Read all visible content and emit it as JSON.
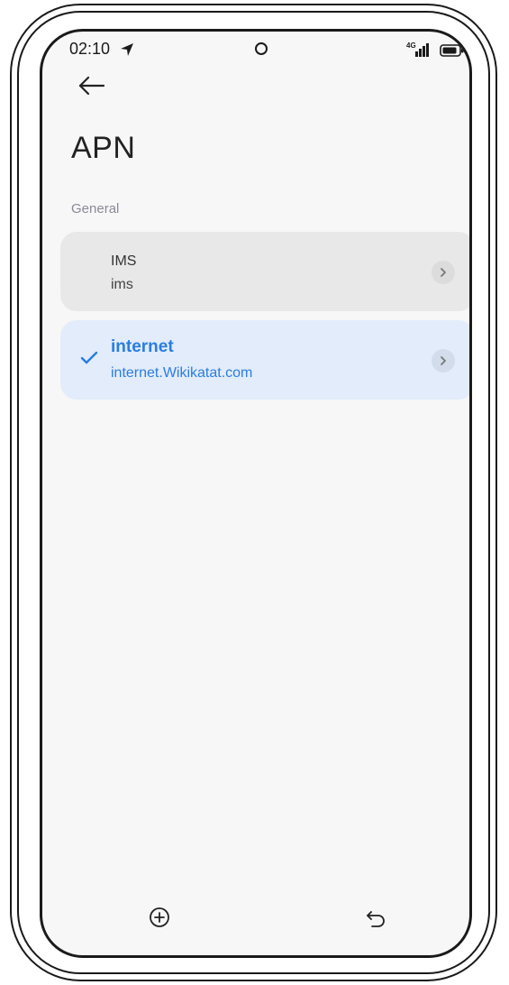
{
  "status_bar": {
    "time": "02:10",
    "network": "4G"
  },
  "page": {
    "title": "APN",
    "section_label": "General"
  },
  "apn_list": [
    {
      "name": "IMS",
      "value": "ims",
      "selected": false
    },
    {
      "name": "internet",
      "value": "internet.Wikikatat.com",
      "selected": true
    }
  ],
  "colors": {
    "accent": "#2a7de1",
    "selected_bg": "#e2ecfa",
    "item_bg": "#e8e8e8",
    "screen_bg": "#f7f7f7"
  },
  "icons": {
    "back": "arrow-left-icon",
    "add": "plus-circle-icon",
    "reset": "undo-icon",
    "check": "check-icon",
    "chevron": "chevron-right-icon"
  }
}
